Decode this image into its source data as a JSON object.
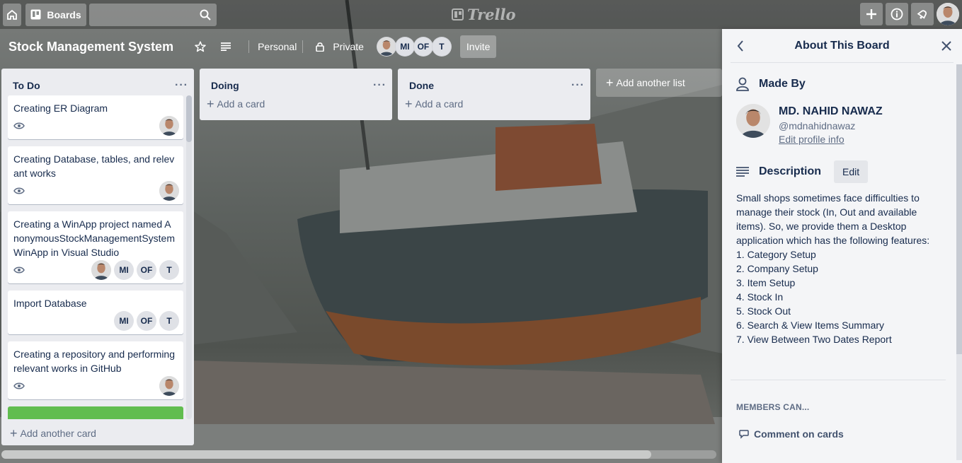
{
  "topbar": {
    "boards_label": "Boards",
    "search_placeholder": "",
    "logo_text": "Trello"
  },
  "board": {
    "title": "Stock Management System",
    "team_label": "Personal",
    "visibility_label": "Private",
    "members": [
      "MI",
      "OF",
      "T"
    ],
    "invite_label": "Invite"
  },
  "lists": [
    {
      "title": "To Do",
      "cards": [
        {
          "text": "Creating ER Diagram",
          "members": [
            "photo"
          ]
        },
        {
          "text": "Creating Database, tables, and relevant works",
          "members": [
            "photo"
          ]
        },
        {
          "text": "Creating a WinApp project named AnonymousStockManagementSystemWinApp in Visual Studio",
          "members": [
            "photo",
            "MI",
            "OF",
            "T"
          ]
        },
        {
          "text": "Import Database",
          "members": [
            "MI",
            "OF",
            "T"
          ]
        },
        {
          "text": "Creating a repository and performing relevant works in GitHub",
          "members": [
            "photo"
          ]
        }
      ],
      "add_card_label": "Add another card"
    },
    {
      "title": "Doing",
      "add_card_label": "Add a card"
    },
    {
      "title": "Done",
      "add_card_label": "Add a card"
    }
  ],
  "add_list_label": "Add another list",
  "panel": {
    "title": "About This Board",
    "made_by_label": "Made By",
    "owner_name": "MD. NAHID NAWAZ",
    "owner_username": "@mdnahidnawaz",
    "edit_profile_label": "Edit profile info",
    "description_label": "Description",
    "edit_label": "Edit",
    "description_text": "Small shops sometimes face difficulties to manage their stock (In, Out and available items). So, we provide them a Desktop application which has the following features:\n1. Category Setup\n2. Company Setup\n3. Item Setup\n4. Stock In\n5. Stock Out\n6. Search & View Items Summary\n7. View Between Two Dates Report",
    "members_can_label": "MEMBERS CAN...",
    "comment_label": "Comment on cards"
  },
  "colors": {
    "list_bg": "#ebecf0",
    "label_green": "#61bd4f",
    "panel_bg": "#f4f5f7"
  }
}
